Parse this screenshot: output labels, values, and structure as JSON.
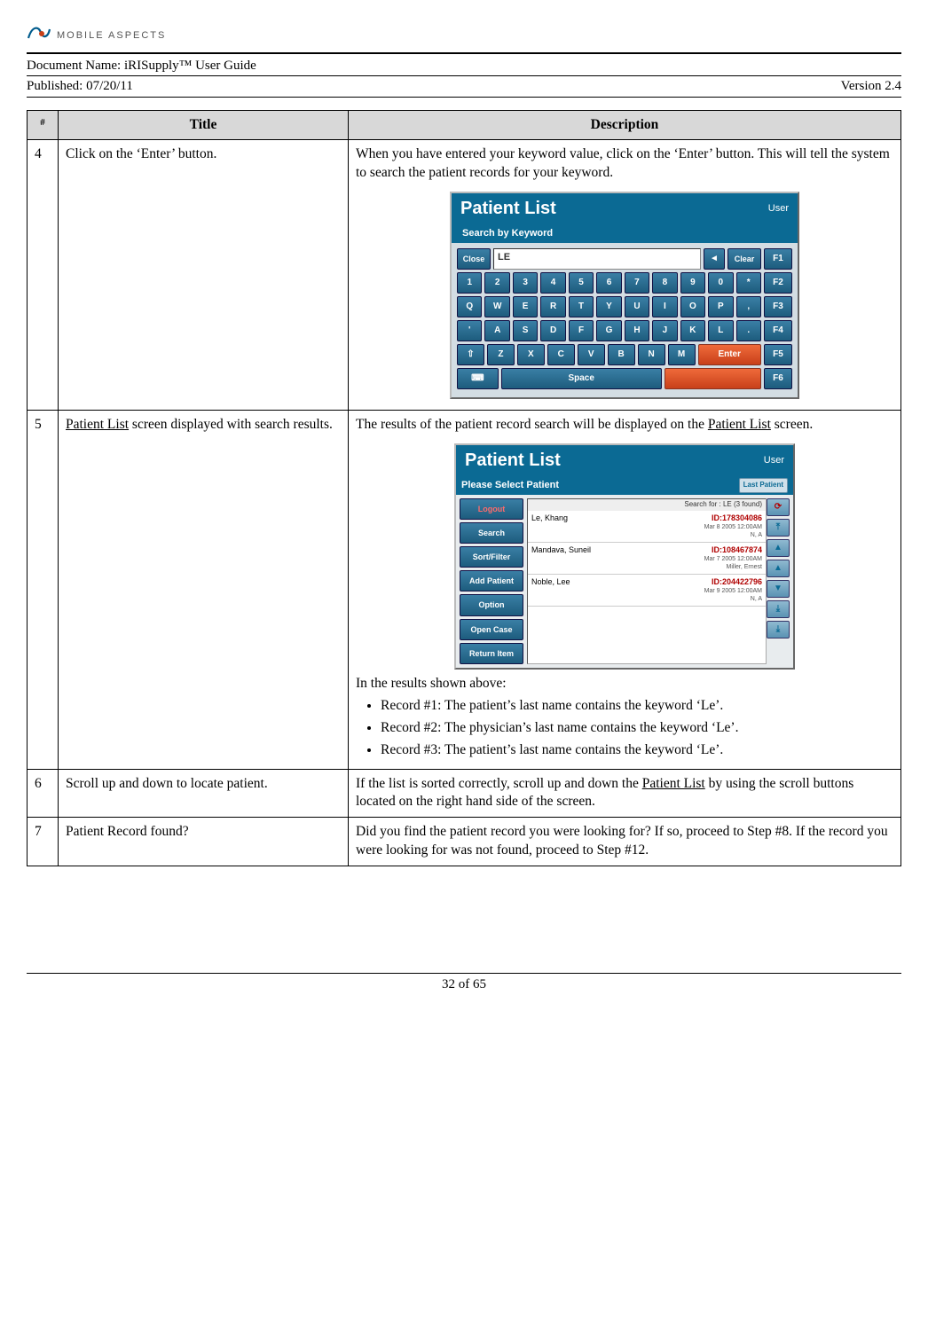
{
  "logo_text": "MOBILE ASPECTS",
  "doc_name_label": "Document Name:  ",
  "doc_name": "iRISupply™ User Guide",
  "published_label": "Published:  ",
  "published": "07/20/11",
  "version": "Version 2.4",
  "headers": {
    "hash": "#",
    "title": "Title",
    "desc": "Description"
  },
  "rows": {
    "r4": {
      "num": "4",
      "title": "Click on the ‘Enter’ button.",
      "desc": "When you have entered your keyword value, click on the ‘Enter’ button.  This will tell the system to search the patient records for your keyword."
    },
    "r5": {
      "num": "5",
      "title_pre": "Patient List",
      "title_post": " screen displayed with search results.",
      "desc_pre": "The results of the patient record search will be displayed on the ",
      "desc_link": "Patient List",
      "desc_post": " screen.",
      "after": "In the results shown above:",
      "b1": "Record #1:  The patient’s last name contains the keyword ‘Le’.",
      "b2": "Record #2:  The physician’s last name contains the keyword ‘Le’.",
      "b3": "Record #3:  The patient’s last name contains the keyword ‘Le’."
    },
    "r6": {
      "num": "6",
      "title": "Scroll up and down to locate patient.",
      "desc_pre": "If the list is sorted correctly, scroll up and down the ",
      "desc_link": "Patient List",
      "desc_post": " by using the scroll buttons located on the right hand side of the screen."
    },
    "r7": {
      "num": "7",
      "title": "Patient Record found?",
      "desc": "Did you find the patient record you were looking for?  If so, proceed to Step #8.  If the record you were looking for was not found, proceed to Step #12."
    }
  },
  "shot1": {
    "title": "Patient List",
    "user": "User",
    "sub": "Search by Keyword",
    "close": "Close",
    "input": "LE",
    "back": "◄",
    "clear": "Clear",
    "f": [
      "F1",
      "F2",
      "F3",
      "F4",
      "F5",
      "F6"
    ],
    "row1": [
      "1",
      "2",
      "3",
      "4",
      "5",
      "6",
      "7",
      "8",
      "9",
      "0",
      "*"
    ],
    "row2": [
      "Q",
      "W",
      "E",
      "R",
      "T",
      "Y",
      "U",
      "I",
      "O",
      "P",
      ","
    ],
    "row3": [
      "'",
      "A",
      "S",
      "D",
      "F",
      "G",
      "H",
      "J",
      "K",
      "L",
      "."
    ],
    "row4": [
      "⇧",
      "Z",
      "X",
      "C",
      "V",
      "B",
      "N",
      "M"
    ],
    "enter": "Enter",
    "space": "Space",
    "kb_icon": "⌨"
  },
  "shot2": {
    "title": "Patient List",
    "user": "User",
    "sub": "Please Select Patient",
    "last": "Last Patient",
    "search_for": "Search for : LE  (3 found)",
    "side": [
      "Logout",
      "Search",
      "Sort/Filter",
      "Add Patient",
      "Option",
      "Open Case",
      "Return Item"
    ],
    "rows": [
      {
        "name": "Le, Khang",
        "id": "ID:178304086",
        "d": "Mar  8 2005 12:00AM",
        "p": "N, A"
      },
      {
        "name": "Mandava, Suneil",
        "id": "ID:108467874",
        "d": "Mar  7 2005 12:00AM",
        "p": "Miller, Ernest"
      },
      {
        "name": "Noble, Lee",
        "id": "ID:204422796",
        "d": "Mar  9 2005 12:00AM",
        "p": "N, A"
      }
    ],
    "nav": [
      "⟳",
      "⤒",
      "▲",
      "▲",
      "▼",
      "⤓",
      "⤓"
    ]
  },
  "footer": "32 of 65"
}
